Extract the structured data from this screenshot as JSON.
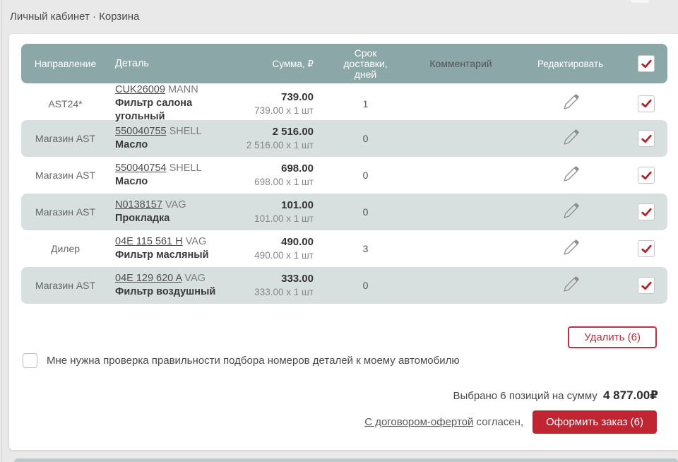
{
  "page": {
    "breadcrumb": "Личный кабинет · Корзина"
  },
  "colors": {
    "accent_red": "#c22532",
    "header_teal": "#8ca7a8",
    "row_alt": "#d7dfdf",
    "check_red": "#b32027"
  },
  "table": {
    "headers": {
      "direction": "Направление",
      "part": "Деталь",
      "sum": "Сумма, ₽",
      "delivery": "Срок доставки, дней",
      "comment": "Комментарий",
      "edit": "Редактировать"
    },
    "header_checkbox_checked": true,
    "rows": [
      {
        "direction": "AST24*",
        "part_number": "CUK26009",
        "brand": "MANN",
        "part_name": "Фильтр салона угольный",
        "sum": "739.00",
        "sum_detail": "739.00 x 1 шт",
        "delivery_days": "1",
        "comment": "",
        "checked": true
      },
      {
        "direction": "Магазин AST",
        "part_number": "550040755",
        "brand": "SHELL",
        "part_name": "Масло",
        "sum": "2 516.00",
        "sum_detail": "2 516.00 x 1 шт",
        "delivery_days": "0",
        "comment": "",
        "checked": true
      },
      {
        "direction": "Магазин AST",
        "part_number": "550040754",
        "brand": "SHELL",
        "part_name": "Масло",
        "sum": "698.00",
        "sum_detail": "698.00 x 1 шт",
        "delivery_days": "0",
        "comment": "",
        "checked": true
      },
      {
        "direction": "Магазин AST",
        "part_number": "N0138157",
        "brand": "VAG",
        "part_name": "Прокладка",
        "sum": "101.00",
        "sum_detail": "101.00 x 1 шт",
        "delivery_days": "0",
        "comment": "",
        "checked": true
      },
      {
        "direction": "Дилер",
        "part_number": "04E 115 561 H",
        "brand": "VAG",
        "part_name": "Фильтр масляный",
        "sum": "490.00",
        "sum_detail": "490.00 x 1 шт",
        "delivery_days": "3",
        "comment": "",
        "checked": true
      },
      {
        "direction": "Магазин AST",
        "part_number": "04E 129 620 A",
        "brand": "VAG",
        "part_name": "Фильтр воздушный",
        "sum": "333.00",
        "sum_detail": "333.00 x 1 шт",
        "delivery_days": "0",
        "comment": "",
        "checked": true
      }
    ]
  },
  "actions": {
    "delete_label": "Удалить (6)",
    "check_request_label": "Мне нужна проверка правильности подбора номеров деталей к моему автомобилю",
    "check_request_checked": false,
    "summary_prefix": "Выбрано 6 позиций на сумму",
    "summary_total": "4 877.00₽",
    "offer_link": "С договором-офертой",
    "offer_suffix": "согласен,",
    "checkout_label": "Оформить заказ (6)"
  }
}
